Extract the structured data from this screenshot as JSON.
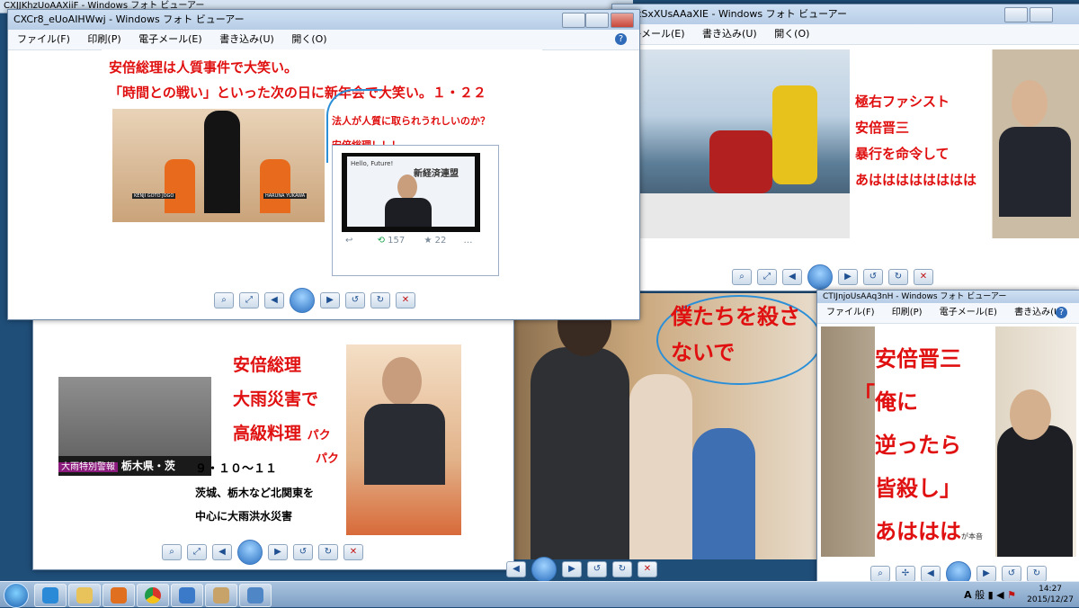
{
  "windows": {
    "w_top_right": {
      "title": "kSxXUsAAaXIE - Windows フォト ビューアー"
    },
    "w_main": {
      "title": "CXCr8_eUoAIHWwj - Windows フォト ビューアー",
      "headline1": "安倍総理は人質事件で大笑い。",
      "headline2": "「時間との戦い」といった次の日に新年会で大笑い。１・２２",
      "callout1": "法人が人質に取られうれしいのか？",
      "callout2": "安倍総理！！！",
      "hostage_left": "KENJI GOTO JOGO",
      "hostage_right": "HARUNA YUKAWA",
      "banner": "Hello, Future!",
      "banner_org": "新経済連盟",
      "tweet_retweets": "157",
      "tweet_likes": "22"
    },
    "w_bottom_left": {
      "line1": "安倍総理",
      "line2": "大雨災害で",
      "line3": "高級料理",
      "paku1": "パク",
      "paku2": "パク",
      "date": "９・１０～１１",
      "desc1": "茨城、栃木など北関東を",
      "desc2": "中心に大雨洪水災害",
      "news_caption": "大雨特別警報",
      "news_region": "栃木県・茨"
    },
    "w_right_photo": {
      "text1": "極右ファシスト",
      "text2": "安倍晋三",
      "text3": "暴行を命令して",
      "text4": "あはははははははは"
    },
    "w_bottom_right": {
      "title": "CTIJnjoUsAAq3nH - Windows フォト ビューアー",
      "line1": "安倍晋三",
      "quote_open": "「",
      "line2": "俺に",
      "line3": "逆ったら",
      "line4": "皆殺し」",
      "line5": "あははは",
      "small": "が本音"
    },
    "center_photo": {
      "handwriting1": "僕たちを殺さ",
      "handwriting2": "ないで"
    },
    "back_title": "CXJJKhzUoAAXiiF - Windows フォト ビューアー"
  },
  "menu": {
    "file": "ファイル(F)",
    "print": "印刷(P)",
    "email": "電子メール(E)",
    "burn": "書き込み(U)",
    "open": "開く(O)",
    "help": "?"
  },
  "toolbar_icons": [
    "zoom-icon",
    "fit-icon",
    "prev-icon",
    "slideshow-icon",
    "next-icon",
    "rotate-left-icon",
    "rotate-right-icon",
    "delete-icon"
  ],
  "taskbar": {
    "time": "14:27",
    "date": "2015/12/27",
    "tray_a": "A",
    "tray_ime": "般"
  }
}
